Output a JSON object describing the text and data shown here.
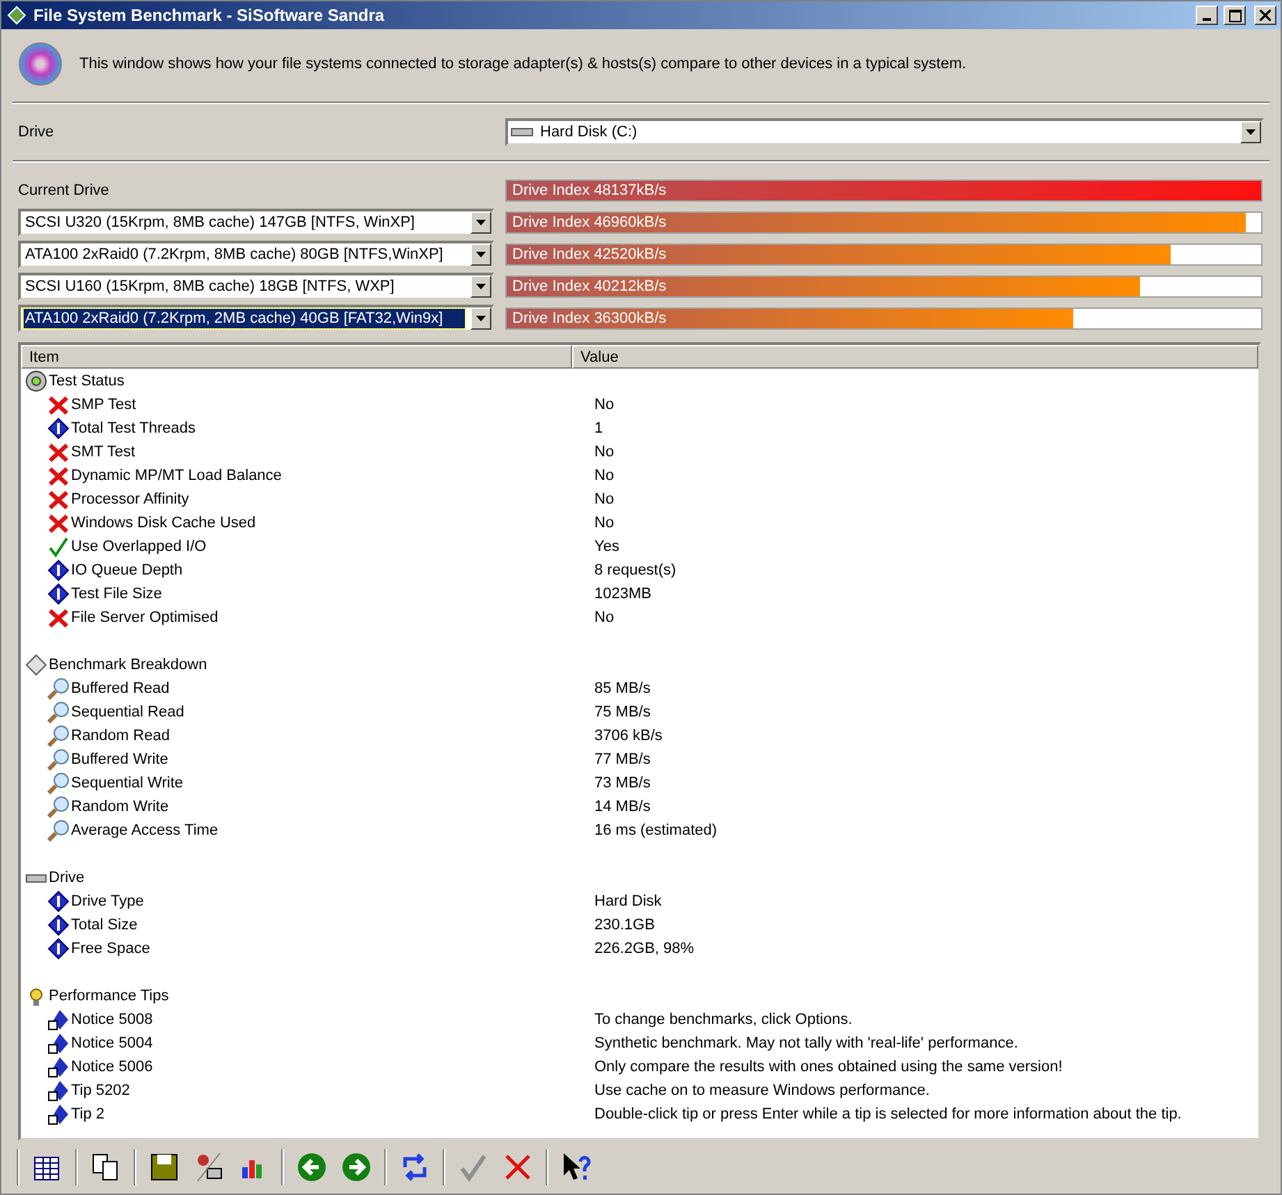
{
  "window": {
    "title": "File System Benchmark - SiSoftware Sandra"
  },
  "description": "This window shows how your file systems connected to storage adapter(s) & hosts(s) compare to other devices in a typical system.",
  "drive": {
    "label": "Drive",
    "value": "Hard Disk (C:)"
  },
  "current": {
    "label": "Current Drive",
    "bar": "Drive Index 48137kB/s",
    "level": 1
  },
  "comparisons": [
    {
      "device": "SCSI U320 (15Krpm, 8MB cache) 147GB [NTFS, WinXP]",
      "selected": false,
      "bar": "Drive Index 46960kB/s",
      "level": 0.98
    },
    {
      "device": "ATA100 2xRaid0 (7.2Krpm, 8MB cache) 80GB [NTFS,WinXP]",
      "selected": false,
      "bar": "Drive Index 42520kB/s",
      "level": 0.88
    },
    {
      "device": "SCSI U160 (15Krpm, 8MB cache) 18GB [NTFS, WXP]",
      "selected": false,
      "bar": "Drive Index 40212kB/s",
      "level": 0.84
    },
    {
      "device": "ATA100 2xRaid0 (7.2Krpm, 2MB cache) 40GB [FAT32,Win9x]",
      "selected": true,
      "bar": "Drive Index 36300kB/s",
      "level": 0.75
    }
  ],
  "list": {
    "columns": [
      "Item",
      "Value"
    ],
    "groups": [
      {
        "kind": "status",
        "label": "Test Status",
        "children": [
          {
            "kind": "fail",
            "item": "SMP Test",
            "value": "No"
          },
          {
            "kind": "info",
            "item": "Total Test Threads",
            "value": "1"
          },
          {
            "kind": "fail",
            "item": "SMT Test",
            "value": "No"
          },
          {
            "kind": "fail",
            "item": "Dynamic MP/MT Load Balance",
            "value": "No"
          },
          {
            "kind": "fail",
            "item": "Processor Affinity",
            "value": "No"
          },
          {
            "kind": "fail",
            "item": "Windows Disk Cache Used",
            "value": "No"
          },
          {
            "kind": "ok",
            "item": "Use Overlapped I/O",
            "value": "Yes"
          },
          {
            "kind": "info",
            "item": "IO Queue Depth",
            "value": "8 request(s)"
          },
          {
            "kind": "info",
            "item": "Test File Size",
            "value": "1023MB"
          },
          {
            "kind": "fail",
            "item": "File Server Optimised",
            "value": "No"
          }
        ]
      },
      {
        "kind": "bench",
        "label": "Benchmark Breakdown",
        "children": [
          {
            "kind": "bench",
            "item": "Buffered Read",
            "value": "85 MB/s"
          },
          {
            "kind": "bench",
            "item": "Sequential Read",
            "value": "75 MB/s"
          },
          {
            "kind": "bench",
            "item": "Random Read",
            "value": "3706 kB/s"
          },
          {
            "kind": "bench",
            "item": "Buffered Write",
            "value": "77 MB/s"
          },
          {
            "kind": "bench",
            "item": "Sequential Write",
            "value": "73 MB/s"
          },
          {
            "kind": "bench",
            "item": "Random Write",
            "value": "14 MB/s"
          },
          {
            "kind": "bench",
            "item": "Average Access Time",
            "value": "16 ms (estimated)"
          }
        ]
      },
      {
        "kind": "drive",
        "label": "Drive",
        "children": [
          {
            "kind": "info",
            "item": "Drive Type",
            "value": "Hard Disk"
          },
          {
            "kind": "info",
            "item": "Total Size",
            "value": "230.1GB"
          },
          {
            "kind": "info",
            "item": "Free Space",
            "value": "226.2GB, 98%"
          }
        ]
      },
      {
        "kind": "tips",
        "label": "Performance Tips",
        "children": [
          {
            "kind": "tip",
            "item": "Notice 5008",
            "value": "To change benchmarks, click Options."
          },
          {
            "kind": "tip",
            "item": "Notice 5004",
            "value": "Synthetic benchmark. May not tally with 'real-life' performance."
          },
          {
            "kind": "tip",
            "item": "Notice 5006",
            "value": "Only compare the results with ones obtained using the same version!"
          },
          {
            "kind": "tip",
            "item": "Tip 5202",
            "value": "Use cache on to measure Windows performance."
          },
          {
            "kind": "tip",
            "item": "Tip 2",
            "value": "Double-click tip or press Enter while a tip is selected for more information about the tip."
          }
        ]
      }
    ]
  },
  "toolbar": [
    {
      "kind": "report"
    },
    {
      "kind": "sep"
    },
    {
      "kind": "copy"
    },
    {
      "kind": "sep"
    },
    {
      "kind": "save"
    },
    {
      "kind": "user"
    },
    {
      "kind": "chart"
    },
    {
      "kind": "sep"
    },
    {
      "kind": "back"
    },
    {
      "kind": "forward"
    },
    {
      "kind": "sep"
    },
    {
      "kind": "refresh"
    },
    {
      "kind": "sep"
    },
    {
      "kind": "apply",
      "disabled": true
    },
    {
      "kind": "cancel"
    },
    {
      "kind": "sep"
    },
    {
      "kind": "help"
    }
  ]
}
